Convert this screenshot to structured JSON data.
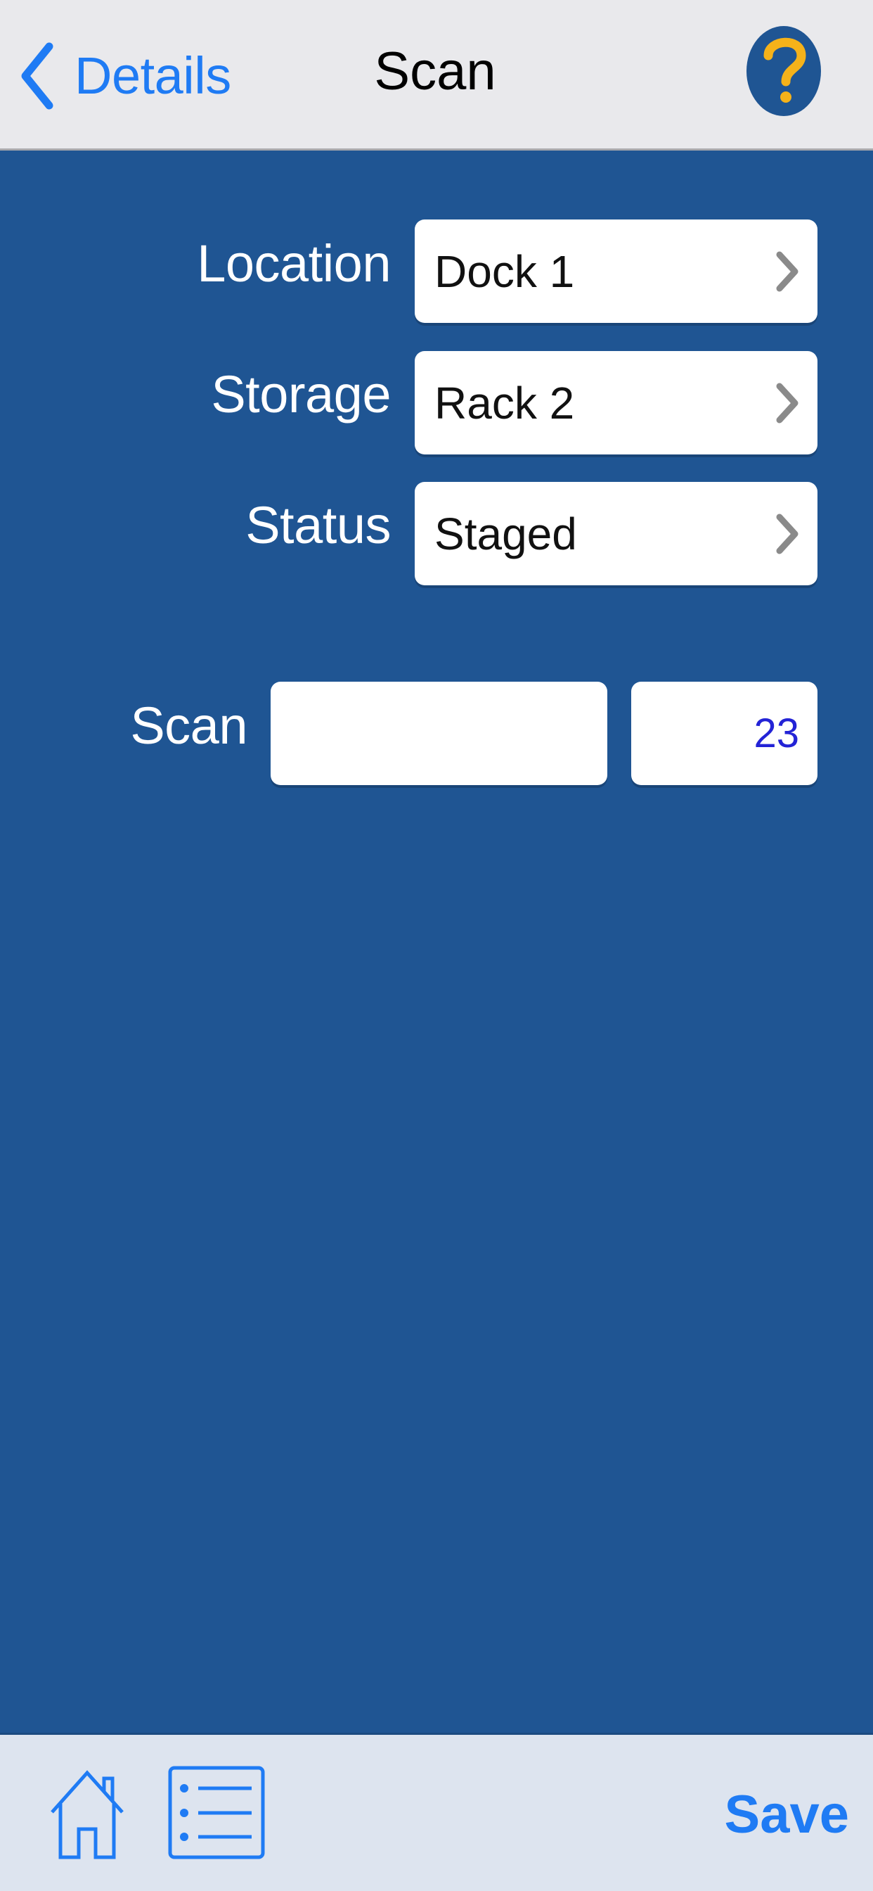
{
  "navbar": {
    "back_label": "Details",
    "title": "Scan",
    "help_icon": "question-mark-circle-icon"
  },
  "form": {
    "location": {
      "label": "Location",
      "value": "Dock 1"
    },
    "storage": {
      "label": "Storage",
      "value": "Rack 2"
    },
    "status": {
      "label": "Status",
      "value": "Staged"
    },
    "scan": {
      "label": "Scan",
      "value": "",
      "count": "23"
    }
  },
  "toolbar": {
    "home_icon": "home-icon",
    "list_icon": "list-icon",
    "save_label": "Save"
  },
  "colors": {
    "background": "#1f5593",
    "accent": "#1f7bf4",
    "help_circle": "#1f5593",
    "help_mark": "#f5b21a",
    "count_text": "#2323d6"
  }
}
